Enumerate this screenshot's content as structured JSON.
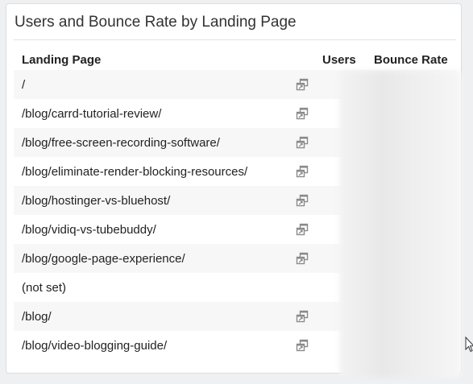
{
  "panel": {
    "title": "Users and Bounce Rate by Landing Page"
  },
  "table": {
    "columns": [
      "Landing Page",
      "Users",
      "Bounce Rate"
    ],
    "rows": [
      {
        "path": "/",
        "has_link": true
      },
      {
        "path": "/blog/carrd-tutorial-review/",
        "has_link": true
      },
      {
        "path": "/blog/free-screen-recording-software/",
        "has_link": true
      },
      {
        "path": "/blog/eliminate-render-blocking-resources/",
        "has_link": true
      },
      {
        "path": "/blog/hostinger-vs-bluehost/",
        "has_link": true
      },
      {
        "path": "/blog/vidiq-vs-tubebuddy/",
        "has_link": true
      },
      {
        "path": "/blog/google-page-experience/",
        "has_link": true
      },
      {
        "path": "(not set)",
        "has_link": false
      },
      {
        "path": "/blog/",
        "has_link": true
      },
      {
        "path": "/blog/video-blogging-guide/",
        "has_link": true
      }
    ]
  },
  "icons": {
    "row_link": "open-in-new-window-icon"
  },
  "colors": {
    "row_alt": "#f7f7f7",
    "text": "#222222",
    "icon": "#8a8a8a"
  }
}
